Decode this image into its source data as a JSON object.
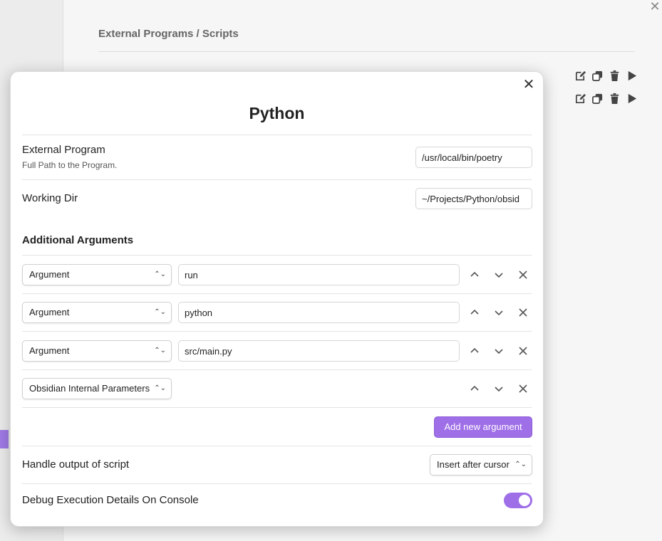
{
  "background": {
    "section_title": "External Programs / Scripts",
    "close_icon": "x-icon",
    "action_icons": [
      "edit-icon",
      "copy-icon",
      "trash-icon",
      "play-icon"
    ]
  },
  "modal": {
    "title": "Python",
    "close_icon": "x-icon",
    "external_program": {
      "label": "External Program",
      "description": "Full Path to the Program.",
      "value": "/usr/local/bin/poetry"
    },
    "working_dir": {
      "label": "Working Dir",
      "value": "~/Projects/Python/obsid"
    },
    "additional_arguments": {
      "heading": "Additional Arguments",
      "rows": [
        {
          "type": "Argument",
          "value": "run"
        },
        {
          "type": "Argument",
          "value": "python"
        },
        {
          "type": "Argument",
          "value": "src/main.py"
        },
        {
          "type": "Obsidian Internal Parameters",
          "value": ""
        }
      ],
      "add_button": "Add new argument"
    },
    "handle_output": {
      "label": "Handle output of script",
      "selected": "Insert after cursor"
    },
    "debug": {
      "label": "Debug Execution Details On Console",
      "enabled": true
    }
  },
  "colors": {
    "accent": "#9f6fe8",
    "background": "#f6f6f6",
    "modal": "#ffffff"
  }
}
